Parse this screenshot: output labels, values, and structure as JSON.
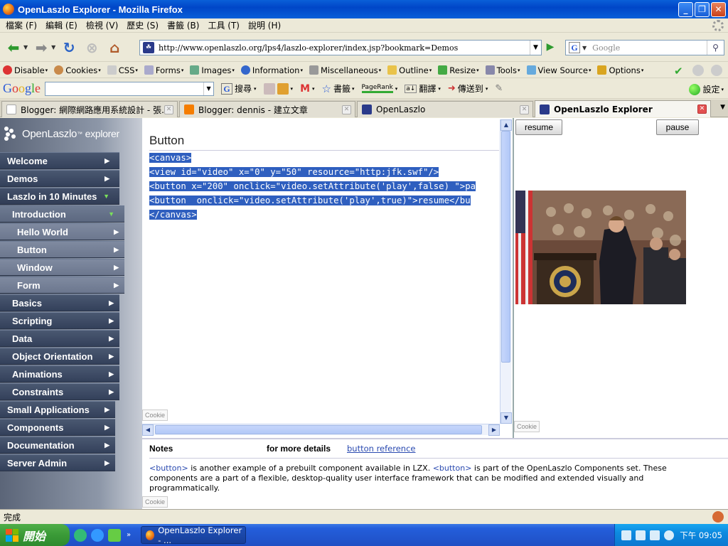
{
  "window": {
    "title": "OpenLaszlo Explorer - Mozilla Firefox"
  },
  "menu": [
    "檔案 (F)",
    "編輯 (E)",
    "檢視 (V)",
    "歷史 (S)",
    "書籤 (B)",
    "工具 (T)",
    "說明 (H)"
  ],
  "navbar": {
    "url": "http://www.openlaszlo.org/lps4/laszlo-explorer/index.jsp?bookmark=Demos",
    "search_placeholder": "Google"
  },
  "devbar": {
    "items": [
      "Disable",
      "Cookies",
      "CSS",
      "Forms",
      "Images",
      "Information",
      "Miscellaneous",
      "Outline",
      "Resize",
      "Tools",
      "View Source",
      "Options"
    ]
  },
  "googlebar": {
    "logo": "Google",
    "search": "搜尋",
    "bookmarks": "書籤",
    "pagerank": "PageRank",
    "translate": "翻譯",
    "send": "傳送到",
    "settings": "設定"
  },
  "tabs": [
    {
      "label": "Blogger: 網際網路應用系統設計 - 張...",
      "active": false
    },
    {
      "label": "Blogger: dennis - 建立文章",
      "active": false
    },
    {
      "label": "OpenLaszlo",
      "active": false
    },
    {
      "label": "OpenLaszlo Explorer",
      "active": true
    }
  ],
  "sidebar": {
    "logo_text": "OpenLaszlo",
    "logo_sup": "™",
    "logo_suffix": "explorer",
    "items": [
      {
        "label": "Welcome",
        "level": 0
      },
      {
        "label": "Demos",
        "level": 0
      },
      {
        "label": "Laszlo in 10 Minutes",
        "level": 0
      },
      {
        "label": "Introduction",
        "level": 1
      },
      {
        "label": "Hello World",
        "level": 2
      },
      {
        "label": "Button",
        "level": 2
      },
      {
        "label": "Window",
        "level": 2
      },
      {
        "label": "Form",
        "level": 2
      },
      {
        "label": "Basics",
        "level": 1
      },
      {
        "label": "Scripting",
        "level": 1
      },
      {
        "label": "Data",
        "level": 1
      },
      {
        "label": "Object Orientation",
        "level": 1
      },
      {
        "label": "Animations",
        "level": 1
      },
      {
        "label": "Constraints",
        "level": 1
      },
      {
        "label": "Small Applications",
        "level": 0
      },
      {
        "label": "Components",
        "level": 0
      },
      {
        "label": "Documentation",
        "level": 0
      },
      {
        "label": "Server Admin",
        "level": 0
      }
    ]
  },
  "editor": {
    "title": "Button",
    "lines": [
      "<canvas>",
      "<view id=\"video\" x=\"0\" y=\"50\" resource=\"http:jfk.swf\"/>",
      "<button x=\"200\" onclick=\"video.setAttribute('play',false) \">pa",
      "<button  onclick=\"video.setAttribute('play',true)\">resume</bu",
      "</canvas>"
    ],
    "cookie": "Cookie"
  },
  "preview": {
    "resume": "resume",
    "pause": "pause",
    "cookie": "Cookie"
  },
  "notes": {
    "heading": "Notes",
    "details_label": "for more details",
    "details_link": "button reference",
    "tag1": "<button>",
    "text1": " is another example of a prebuilt component available in LZX. ",
    "tag2": "<button>",
    "text2": " is part of the OpenLaszlo Components set. These components are a part of a flexible, desktop-quality user interface framework that can be modified and extended visually and programmatically.",
    "cookie": "Cookie"
  },
  "status": {
    "text": "完成"
  },
  "taskbar": {
    "start": "開始",
    "task": "OpenLaszlo Explorer - ...",
    "time": "下午 09:05"
  }
}
